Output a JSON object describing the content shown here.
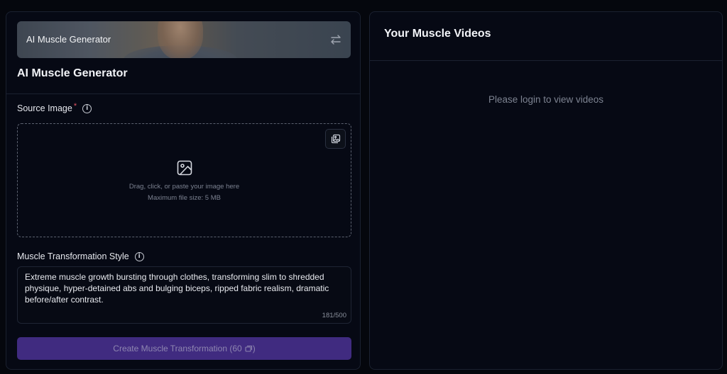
{
  "generator": {
    "banner_label": "AI Muscle Generator",
    "title": "AI Muscle Generator",
    "source_image": {
      "label": "Source Image",
      "required_marker": "*",
      "drop_text_line1": "Drag, click, or paste your image here",
      "drop_text_line2": "Maximum file size: 5 MB"
    },
    "style": {
      "label": "Muscle Transformation Style",
      "value": "Extreme muscle growth bursting through clothes, transforming slim to shredded physique, hyper-detained abs and bulging biceps, ripped fabric realism, dramatic before/after contrast.",
      "char_count": "181/500"
    },
    "create_button": "Create Muscle Transformation (60"
  },
  "videos": {
    "title": "Your Muscle Videos",
    "empty_message": "Please login to view videos"
  },
  "colors": {
    "button_bg": "#402b80",
    "required": "#e25563",
    "background": "#05070d"
  }
}
